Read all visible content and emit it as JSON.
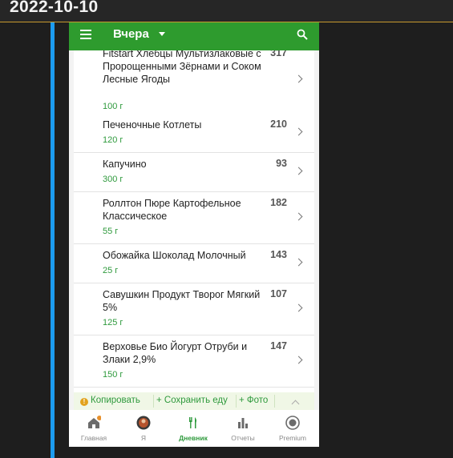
{
  "page": {
    "date": "2022-10-10"
  },
  "appbar": {
    "title": "Вчера"
  },
  "food_items": [
    {
      "name": "Fitstart Хлебцы Мультизлаковые с Пророщенными Зёрнами и Соком Лесные Ягоды",
      "calories": "317",
      "amount": "100 г"
    },
    {
      "name": "Печеночные Котлеты",
      "calories": "210",
      "amount": "120 г"
    },
    {
      "name": "Капучино",
      "calories": "93",
      "amount": "300 г"
    },
    {
      "name": "Роллтон Пюре Картофельное Классическое",
      "calories": "182",
      "amount": "55 г"
    },
    {
      "name": "Обожайка Шоколад Молочный",
      "calories": "143",
      "amount": "25 г"
    },
    {
      "name": "Савушкин Продукт Творог Мягкий 5%",
      "calories": "107",
      "amount": "125 г"
    },
    {
      "name": "Верховье Био Йогурт Отруби и Злаки 2,9%",
      "calories": "147",
      "amount": "150 г"
    }
  ],
  "actions": {
    "copy": "Копировать",
    "save_meal": "+ Сохранить еду",
    "photo": "+ Фото"
  },
  "bottom_nav": [
    {
      "label": "Главная",
      "icon": "home-icon"
    },
    {
      "label": "Я",
      "icon": "avatar"
    },
    {
      "label": "Дневник",
      "icon": "fork-knife-icon"
    },
    {
      "label": "Отчеты",
      "icon": "bar-chart-icon"
    },
    {
      "label": "Premium",
      "icon": "premium-icon"
    }
  ],
  "colors": {
    "brand_green": "#2e9b2e",
    "accent_blue": "#1c9cf0",
    "header_line": "#c99a2e",
    "notification_dot": "#e8912d"
  }
}
